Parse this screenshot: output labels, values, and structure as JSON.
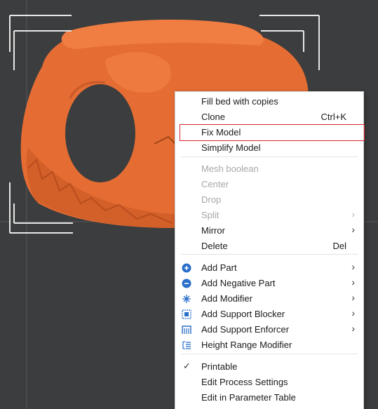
{
  "viewport": {
    "background": "#3c3d3e",
    "model_color": "#e56d33",
    "bed_grid_color": "#55585a"
  },
  "context_menu": {
    "items": [
      {
        "label": "Fill bed with copies"
      },
      {
        "label": "Clone",
        "shortcut": "Ctrl+K"
      },
      {
        "label": "Fix Model",
        "highlighted": true
      },
      {
        "label": "Simplify Model"
      },
      {
        "label": "Mesh boolean",
        "disabled": true
      },
      {
        "label": "Center",
        "disabled": true
      },
      {
        "label": "Drop",
        "disabled": true
      },
      {
        "label": "Split",
        "disabled": true,
        "submenu": true
      },
      {
        "label": "Mirror",
        "submenu": true
      },
      {
        "label": "Delete",
        "shortcut": "Del"
      },
      {
        "label": "Add Part",
        "icon": "add-part-icon",
        "submenu": true
      },
      {
        "label": "Add Negative Part",
        "icon": "add-negative-part-icon",
        "submenu": true
      },
      {
        "label": "Add Modifier",
        "icon": "add-modifier-icon",
        "submenu": true
      },
      {
        "label": "Add Support Blocker",
        "icon": "support-blocker-icon",
        "submenu": true
      },
      {
        "label": "Add Support Enforcer",
        "icon": "support-enforcer-icon",
        "submenu": true
      },
      {
        "label": "Height Range Modifier",
        "icon": "height-range-icon"
      },
      {
        "label": "Printable",
        "checked": true
      },
      {
        "label": "Edit Process Settings"
      },
      {
        "label": "Edit in Parameter Table"
      }
    ],
    "highlight_color": "#d9262c",
    "icon_color": "#2a6fc9"
  }
}
